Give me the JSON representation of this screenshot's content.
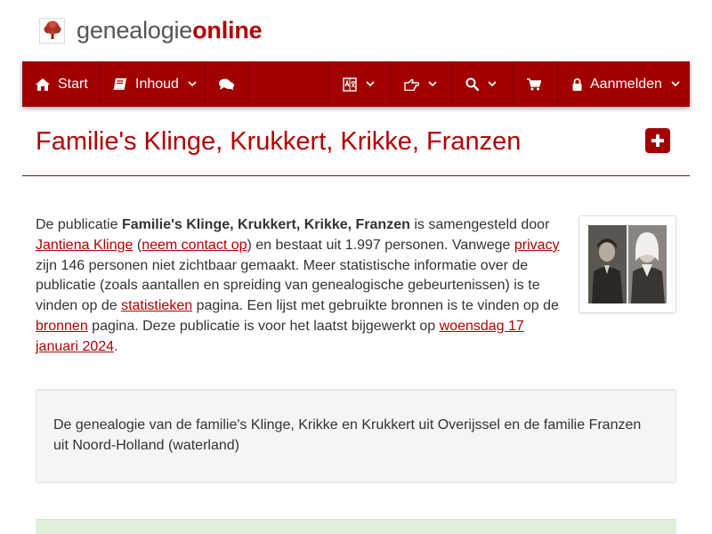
{
  "logo": {
    "text_part1": "genealogie",
    "text_part2": "online"
  },
  "navbar": {
    "items": [
      {
        "label": "Start",
        "icon": "home-icon"
      },
      {
        "label": "Inhoud",
        "icon": "book-icon"
      },
      {
        "label": "",
        "icon": "comments-icon"
      },
      {
        "label": "",
        "icon": "language-icon"
      },
      {
        "label": "",
        "icon": "hand-pointer-icon"
      },
      {
        "label": "",
        "icon": "search-icon"
      },
      {
        "label": "",
        "icon": "cart-icon"
      },
      {
        "label": "Aanmelden",
        "icon": "lock-icon"
      }
    ]
  },
  "page": {
    "title": "Familie's Klinge, Krukkert, Krikke, Franzen",
    "description": {
      "t1": "De publicatie ",
      "pub_name": "Familie's Klinge, Krukkert, Krikke, Franzen",
      "t2": " is samengesteld door ",
      "author_link": "Jantiena Klinge",
      "t3": " (",
      "contact_link": "neem contact op",
      "t4": ") en bestaat uit 1.997 personen. Vanwege ",
      "privacy_link": "privacy",
      "t5": " zijn 146 personen niet zichtbaar gemaakt. Meer statistische informatie over de publicatie (zoals aantallen en spreiding van genealogische gebeurtenissen) is te vinden op de ",
      "stats_link": "statistieken",
      "t6": " pagina. Een lijst met gebruikte bronnen is te vinden op de ",
      "sources_link": "bronnen",
      "t7": " pagina. Deze publicatie is voor het laatst bijgewerkt op ",
      "date_link": "woensdag 17 januari 2024",
      "t8": "."
    },
    "summary": "De genealogie van de familie's Klinge, Krikke en Krukkert uit Overijssel en de familie Franzen uit Noord-Holland (waterland)"
  },
  "colors": {
    "brand": "#a00000",
    "title": "#b30000",
    "panel_bg": "#f5f5f5",
    "success_bg": "#dff0d8"
  }
}
